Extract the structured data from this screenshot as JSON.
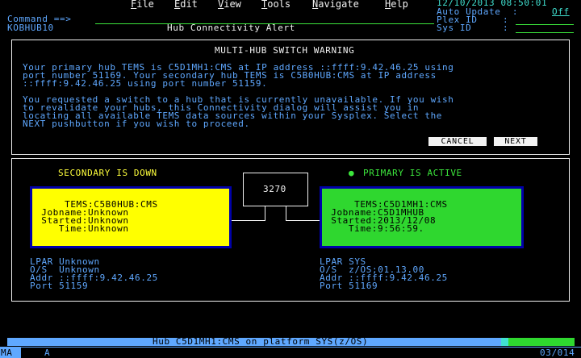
{
  "menu": {
    "items": [
      {
        "label": "File",
        "key": "F",
        "rest": "ile"
      },
      {
        "label": "Edit",
        "key": "E",
        "rest": "dit"
      },
      {
        "label": "View",
        "key": "V",
        "rest": "iew"
      },
      {
        "label": "Tools",
        "key": "T",
        "rest": "ools"
      },
      {
        "label": "Navigate",
        "key": "N",
        "rest": "avigate"
      },
      {
        "label": "Help",
        "key": "H",
        "rest": "elp"
      }
    ]
  },
  "header": {
    "datetime": "12/10/2013 08:50:01",
    "auto_update_label": "Auto Update  :",
    "auto_update_value": "Off",
    "plex_label": "Plex ID",
    "plex_sep": ":",
    "sys_label": "Sys ID",
    "sys_sep": ":",
    "command_label": "Command ==>",
    "hub_name": "KOBHUB10",
    "panel_title": "Hub Connectivity Alert"
  },
  "warning": {
    "title": "MULTI-HUB SWITCH WARNING",
    "para1": [
      "Your primary hub TEMS is C5D1MH1:CMS at IP address ::ffff:9.42.46.25 using",
      "port number 51169. Your secondary hub TEMS is C5B0HUB:CMS at IP address",
      "::ffff:9.42.46.25 using port number 51159."
    ],
    "para2": [
      "You requested a switch to a hub that is currently unavailable. If you wish",
      "to revalidate your hubs, this Connectivity dialog will assist you in",
      "locating all available TEMS data sources within your Sysplex. Select the",
      "NEXT pushbutton if you wish to proceed."
    ],
    "cancel_label": "CANCEL",
    "next_label": "NEXT"
  },
  "diagram": {
    "terminal_label": "3270",
    "secondary": {
      "status": "SECONDARY IS DOWN",
      "lines": [
        "     TEMS:C5B0HUB:CMS",
        " Jobname:Unknown",
        " Started:Unknown",
        "    Time:Unknown"
      ],
      "lpar": [
        "LPAR Unknown",
        "O/S  Unknown",
        "Addr ::ffff:9.42.46.25",
        "Port 51159"
      ],
      "color": "#ffff00"
    },
    "primary": {
      "status_icon": "●",
      "status": "PRIMARY IS ACTIVE",
      "lines": [
        "     TEMS:C5D1MH1:CMS",
        " Jobname:C5D1MHUB",
        " Started:2013/12/08",
        "    Time:9:56:59."
      ],
      "lpar": [
        "LPAR SYS",
        "O/S  z/OS;01.13.00",
        "Addr ::ffff:9.42.46.25",
        "Port 51169"
      ],
      "color": "#2fd72f"
    }
  },
  "status_bar": {
    "text": "Hub C5D1MH1:CMS on platform SYS(z/OS)",
    "bottom_left": "MA",
    "bottom_mode": "A",
    "position": "03/014"
  }
}
